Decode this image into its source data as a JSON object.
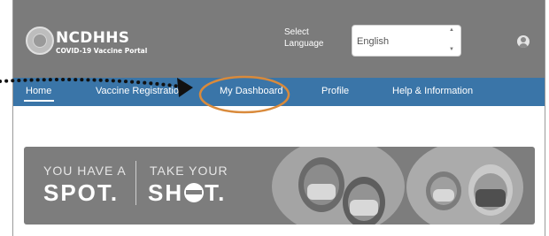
{
  "header": {
    "brand": "NCDHHS",
    "brand_sub": "COVID-19 Vaccine Portal",
    "language_label": "Select Language",
    "language_value": "English"
  },
  "nav": {
    "items": [
      {
        "label": "Home"
      },
      {
        "label": "Vaccine Registration"
      },
      {
        "label": "My Dashboard"
      },
      {
        "label": "Profile"
      },
      {
        "label": "Help & Information"
      }
    ],
    "active": "Home"
  },
  "banner": {
    "left_top": "YOU HAVE A",
    "left_big": "SPOT.",
    "right_top": "TAKE YOUR",
    "right_big_pre": "SH",
    "right_big_post": "T."
  },
  "annotation": {
    "circled_item": "My Dashboard",
    "highlight_color": "#d98a3b",
    "arrow_color": "#111111"
  },
  "colors": {
    "header_bg": "#7b7b7b",
    "nav_bg": "#3a75a8",
    "banner_bg": "#7d7d7d"
  }
}
